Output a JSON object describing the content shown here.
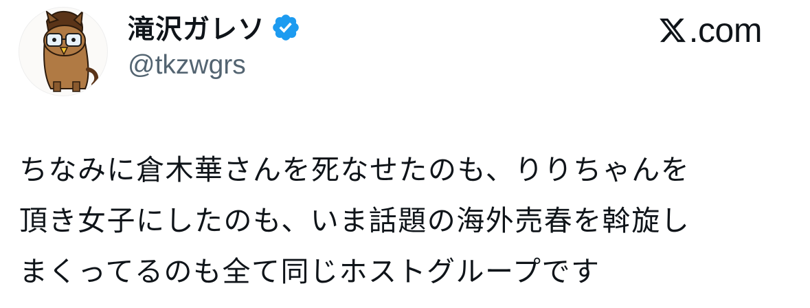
{
  "author": {
    "display_name": "滝沢ガレソ",
    "handle": "@tkzwgrs",
    "verified": true,
    "avatar_icon": "horse-mascot-avatar-icon",
    "badge_color": "#1d9bf0"
  },
  "source": {
    "brand_icon": "x-logo-icon",
    "brand_text": ".com"
  },
  "tweet": {
    "lines": [
      "ちなみに倉木華さんを死なせたのも、りりちゃんを",
      "頂き女子にしたのも、いま話題の海外売春を斡旋し",
      "まくってるのも全て同じホストグループです"
    ]
  },
  "colors": {
    "text": "#0f1419",
    "secondary": "#536471",
    "background": "#ffffff"
  }
}
